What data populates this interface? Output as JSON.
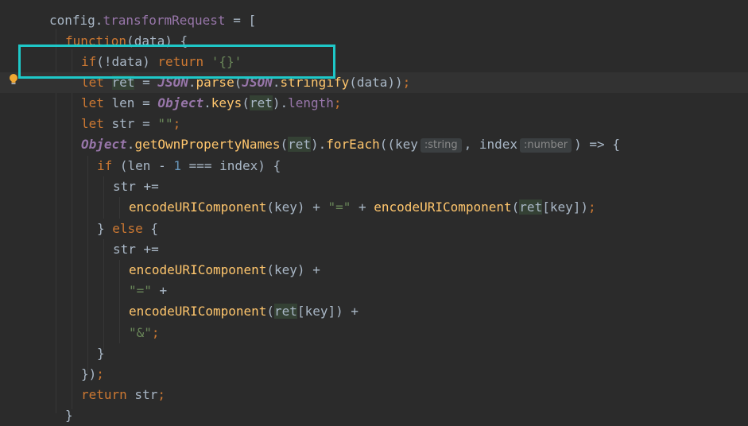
{
  "editor": {
    "language": "javascript",
    "theme_colors": {
      "background": "#2b2b2b",
      "keyword": "#cc7832",
      "string": "#6a8759",
      "function": "#ffc66d",
      "property": "#9876aa",
      "number": "#6897bb",
      "highlight_box": "#1ec8c8"
    },
    "gutter_icon": "lightbulb-icon",
    "lines": [
      {
        "tokens": [
          {
            "t": "config",
            "c": "plain"
          },
          {
            "t": ".",
            "c": "plain"
          },
          {
            "t": "transformRequest",
            "c": "prop"
          },
          {
            "t": " = [",
            "c": "plain"
          }
        ]
      },
      {
        "tokens": [
          {
            "t": "function",
            "c": "kw"
          },
          {
            "t": "(data) {",
            "c": "plain"
          }
        ]
      },
      {
        "tokens": [
          {
            "t": "if",
            "c": "kw"
          },
          {
            "t": "(!data) ",
            "c": "plain"
          },
          {
            "t": "return",
            "c": "kw"
          },
          {
            "t": " ",
            "c": "plain"
          },
          {
            "t": "'{}'",
            "c": "str"
          }
        ]
      },
      {
        "tokens": [
          {
            "t": "let",
            "c": "kw"
          },
          {
            "t": " ",
            "c": "plain"
          },
          {
            "t": "ret",
            "c": "plain",
            "ref": true
          },
          {
            "t": " = ",
            "c": "plain"
          },
          {
            "t": "JSON",
            "c": "cls"
          },
          {
            "t": ".",
            "c": "plain"
          },
          {
            "t": "parse",
            "c": "fn"
          },
          {
            "t": "(",
            "c": "plain"
          },
          {
            "t": "JSON",
            "c": "cls"
          },
          {
            "t": ".",
            "c": "plain"
          },
          {
            "t": "stringify",
            "c": "fn"
          },
          {
            "t": "(data))",
            "c": "plain"
          },
          {
            "t": ";",
            "c": "kw"
          }
        ]
      },
      {
        "tokens": [
          {
            "t": "let",
            "c": "kw"
          },
          {
            "t": " len = ",
            "c": "plain"
          },
          {
            "t": "Object",
            "c": "cls"
          },
          {
            "t": ".",
            "c": "plain"
          },
          {
            "t": "keys",
            "c": "fn"
          },
          {
            "t": "(",
            "c": "plain"
          },
          {
            "t": "ret",
            "c": "plain",
            "ref": true
          },
          {
            "t": ").",
            "c": "plain"
          },
          {
            "t": "length",
            "c": "prop"
          },
          {
            "t": ";",
            "c": "kw"
          }
        ]
      },
      {
        "tokens": [
          {
            "t": "let",
            "c": "kw"
          },
          {
            "t": " str = ",
            "c": "plain"
          },
          {
            "t": "\"\"",
            "c": "str"
          },
          {
            "t": ";",
            "c": "kw"
          }
        ]
      },
      {
        "tokens": [
          {
            "t": "Object",
            "c": "cls"
          },
          {
            "t": ".",
            "c": "plain"
          },
          {
            "t": "getOwnPropertyNames",
            "c": "fn"
          },
          {
            "t": "(",
            "c": "plain"
          },
          {
            "t": "ret",
            "c": "plain",
            "ref": true
          },
          {
            "t": ").",
            "c": "plain"
          },
          {
            "t": "forEach",
            "c": "fn"
          },
          {
            "t": "((key",
            "c": "plain"
          },
          {
            "hint": ":string"
          },
          {
            "t": ", index",
            "c": "plain"
          },
          {
            "hint": ":number"
          },
          {
            "t": ") => {",
            "c": "plain"
          }
        ]
      },
      {
        "tokens": [
          {
            "t": "if",
            "c": "kw"
          },
          {
            "t": " (len - ",
            "c": "plain"
          },
          {
            "t": "1",
            "c": "num"
          },
          {
            "t": " === index) {",
            "c": "plain"
          }
        ]
      },
      {
        "tokens": [
          {
            "t": "str +=",
            "c": "plain"
          }
        ]
      },
      {
        "tokens": [
          {
            "t": "encodeURIComponent",
            "c": "fn"
          },
          {
            "t": "(key) + ",
            "c": "plain"
          },
          {
            "t": "\"=\"",
            "c": "str"
          },
          {
            "t": " + ",
            "c": "plain"
          },
          {
            "t": "encodeURIComponent",
            "c": "fn"
          },
          {
            "t": "(",
            "c": "plain"
          },
          {
            "t": "ret",
            "c": "plain",
            "ref": true
          },
          {
            "t": "[key])",
            "c": "plain"
          },
          {
            "t": ";",
            "c": "kw"
          }
        ]
      },
      {
        "tokens": [
          {
            "t": "} ",
            "c": "plain"
          },
          {
            "t": "else",
            "c": "kw"
          },
          {
            "t": " {",
            "c": "plain"
          }
        ]
      },
      {
        "tokens": [
          {
            "t": "str +=",
            "c": "plain"
          }
        ]
      },
      {
        "tokens": [
          {
            "t": "encodeURIComponent",
            "c": "fn"
          },
          {
            "t": "(key) +",
            "c": "plain"
          }
        ]
      },
      {
        "tokens": [
          {
            "t": "\"=\"",
            "c": "str"
          },
          {
            "t": " +",
            "c": "plain"
          }
        ]
      },
      {
        "tokens": [
          {
            "t": "encodeURIComponent",
            "c": "fn"
          },
          {
            "t": "(",
            "c": "plain"
          },
          {
            "t": "ret",
            "c": "plain",
            "ref": true
          },
          {
            "t": "[key]) +",
            "c": "plain"
          }
        ]
      },
      {
        "tokens": [
          {
            "t": "\"&\"",
            "c": "str"
          },
          {
            "t": ";",
            "c": "kw"
          }
        ]
      },
      {
        "tokens": [
          {
            "t": "}",
            "c": "plain"
          }
        ]
      },
      {
        "tokens": [
          {
            "t": "})",
            "c": "plain"
          },
          {
            "t": ";",
            "c": "kw"
          }
        ]
      },
      {
        "tokens": [
          {
            "t": "return",
            "c": "kw"
          },
          {
            "t": " str",
            "c": "plain"
          },
          {
            "t": ";",
            "c": "kw"
          }
        ]
      },
      {
        "tokens": [
          {
            "t": "}",
            "c": "plain"
          }
        ]
      }
    ]
  }
}
